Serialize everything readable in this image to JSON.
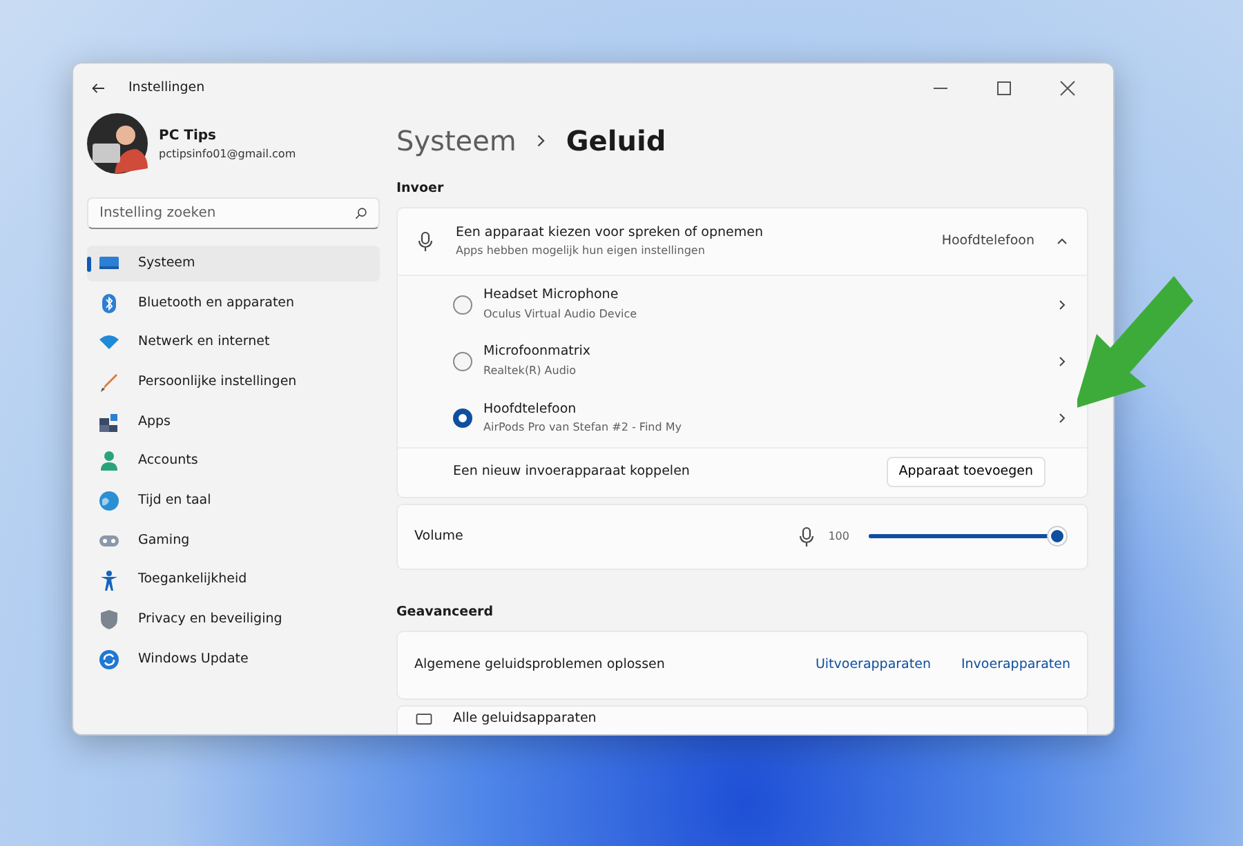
{
  "window": {
    "title": "Instellingen"
  },
  "account": {
    "name": "PC Tips",
    "email": "pctipsinfo01@gmail.com"
  },
  "search": {
    "placeholder": "Instelling zoeken"
  },
  "sidebar": {
    "items": [
      {
        "label": "Systeem",
        "selected": true
      },
      {
        "label": "Bluetooth en apparaten",
        "selected": false
      },
      {
        "label": "Netwerk en internet",
        "selected": false
      },
      {
        "label": "Persoonlijke instellingen",
        "selected": false
      },
      {
        "label": "Apps",
        "selected": false
      },
      {
        "label": "Accounts",
        "selected": false
      },
      {
        "label": "Tijd en taal",
        "selected": false
      },
      {
        "label": "Gaming",
        "selected": false
      },
      {
        "label": "Toegankelijkheid",
        "selected": false
      },
      {
        "label": "Privacy en beveiliging",
        "selected": false
      },
      {
        "label": "Windows Update",
        "selected": false
      }
    ]
  },
  "breadcrumb": [
    "Systeem",
    "Geluid"
  ],
  "input": {
    "heading": "Invoer",
    "chooser": {
      "title": "Een apparaat kiezen voor spreken of opnemen",
      "subtitle": "Apps hebben mogelijk hun eigen instellingen",
      "value": "Hoofdtelefoon",
      "expanded": true
    },
    "devices": [
      {
        "name": "Headset Microphone",
        "detail": "Oculus Virtual Audio Device",
        "selected": false
      },
      {
        "name": "Microfoonmatrix",
        "detail": "Realtek(R) Audio",
        "selected": false
      },
      {
        "name": "Hoofdtelefoon",
        "detail": "AirPods Pro van Stefan #2 - Find My",
        "selected": true
      }
    ],
    "pair": {
      "label": "Een nieuw invoerapparaat koppelen",
      "button": "Apparaat toevoegen"
    },
    "volume": {
      "label": "Volume",
      "reading": "100",
      "level": 1.0
    }
  },
  "advanced": {
    "heading": "Geavanceerd",
    "troubleshoot": {
      "label": "Algemene geluidsproblemen oplossen",
      "links": [
        "Uitvoerapparaten",
        "Invoerapparaten"
      ]
    },
    "all_devices": {
      "label": "Alle geluidsapparaten"
    }
  }
}
